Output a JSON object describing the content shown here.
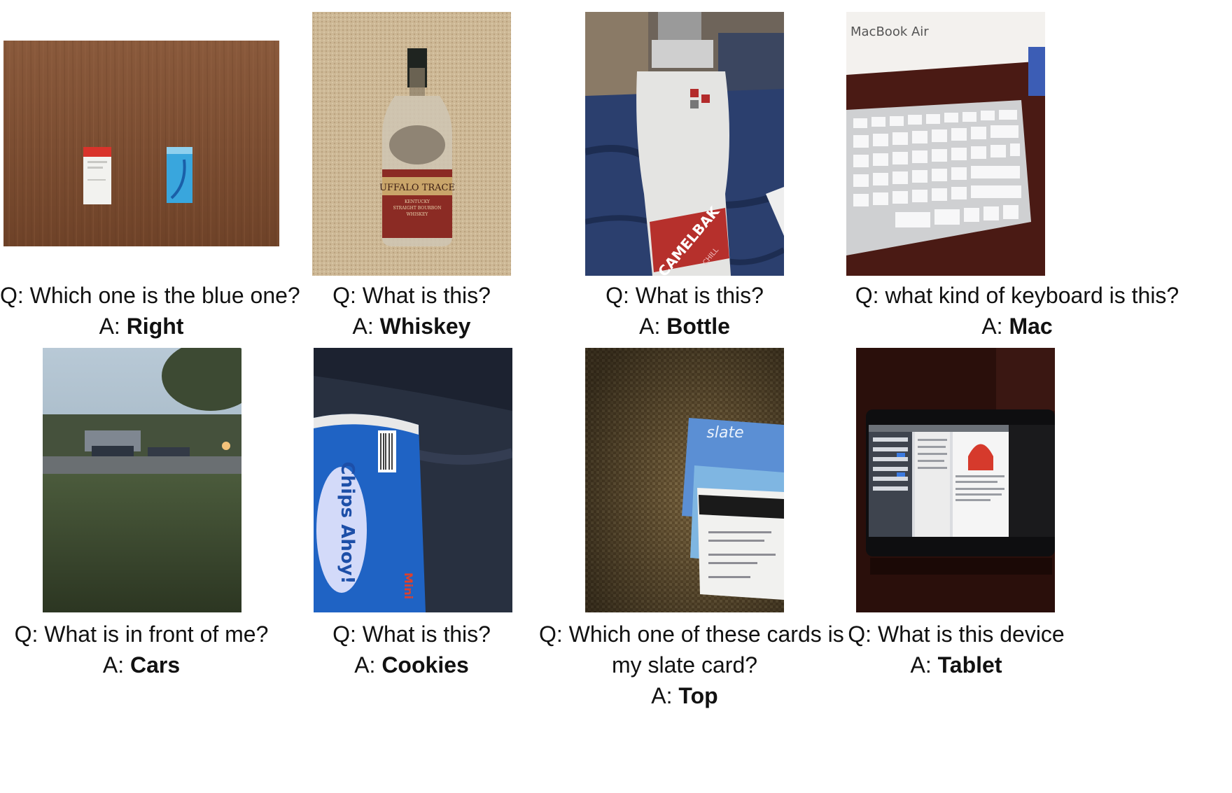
{
  "items": [
    {
      "id": "blue-one",
      "question_prefix": "Q:",
      "question": "Which one is the blue one?",
      "answer_prefix": "A:",
      "answer": "Right",
      "photo_text": []
    },
    {
      "id": "whiskey",
      "question_prefix": "Q:",
      "question": "What is this?",
      "answer_prefix": "A:",
      "answer": "Whiskey",
      "photo_text": [
        "UFFALO TRACE",
        "KENTUCKY",
        "STRAIGHT BOURBON",
        "WHISKEY"
      ]
    },
    {
      "id": "bottle",
      "question_prefix": "Q:",
      "question": "What is this?",
      "answer_prefix": "A:",
      "answer": "Bottle",
      "photo_text": [
        "CAMELBAK",
        "CHILL"
      ]
    },
    {
      "id": "keyboard",
      "question_prefix": "Q:",
      "question": "what kind of keyboard is this?",
      "answer_prefix": "A:",
      "answer": "Mac",
      "photo_text": [
        "MacBook Air"
      ]
    },
    {
      "id": "front-of-me",
      "question_prefix": "Q:",
      "question": "What is in front of me?",
      "answer_prefix": "A:",
      "answer": "Cars",
      "photo_text": []
    },
    {
      "id": "cookies",
      "question_prefix": "Q:",
      "question": "What is this?",
      "answer_prefix": "A:",
      "answer": "Cookies",
      "photo_text": [
        "Chips Ahoy!",
        "Mini"
      ]
    },
    {
      "id": "slate-card",
      "question_prefix": "Q:",
      "question_lines": [
        "Which one of these cards is",
        "my slate card?"
      ],
      "answer_prefix": "A:",
      "answer": "Top",
      "photo_text": [
        "slate"
      ]
    },
    {
      "id": "device",
      "question_prefix": "Q:",
      "question": "What is this device",
      "answer_prefix": "A:",
      "answer": "Tablet",
      "photo_text": []
    }
  ],
  "colors": {
    "background": "#ffffff",
    "text": "#111111"
  }
}
